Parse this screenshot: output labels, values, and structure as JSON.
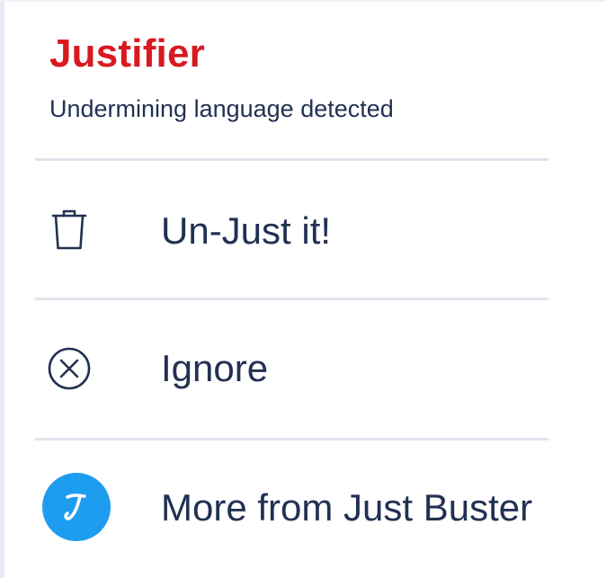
{
  "app": {
    "title": "Justifier",
    "subtitle": "Undermining language detected"
  },
  "menu": {
    "items": [
      {
        "label": "Un-Just it!",
        "icon": "trash-icon"
      },
      {
        "label": "Ignore",
        "icon": "circle-x-icon"
      },
      {
        "label": "More from Just Buster",
        "icon": "just-buster-logo-icon"
      }
    ]
  },
  "colors": {
    "title": "#d91920",
    "text": "#223152",
    "divider": "#dfe4ec",
    "brand": "#1e9cf0"
  }
}
